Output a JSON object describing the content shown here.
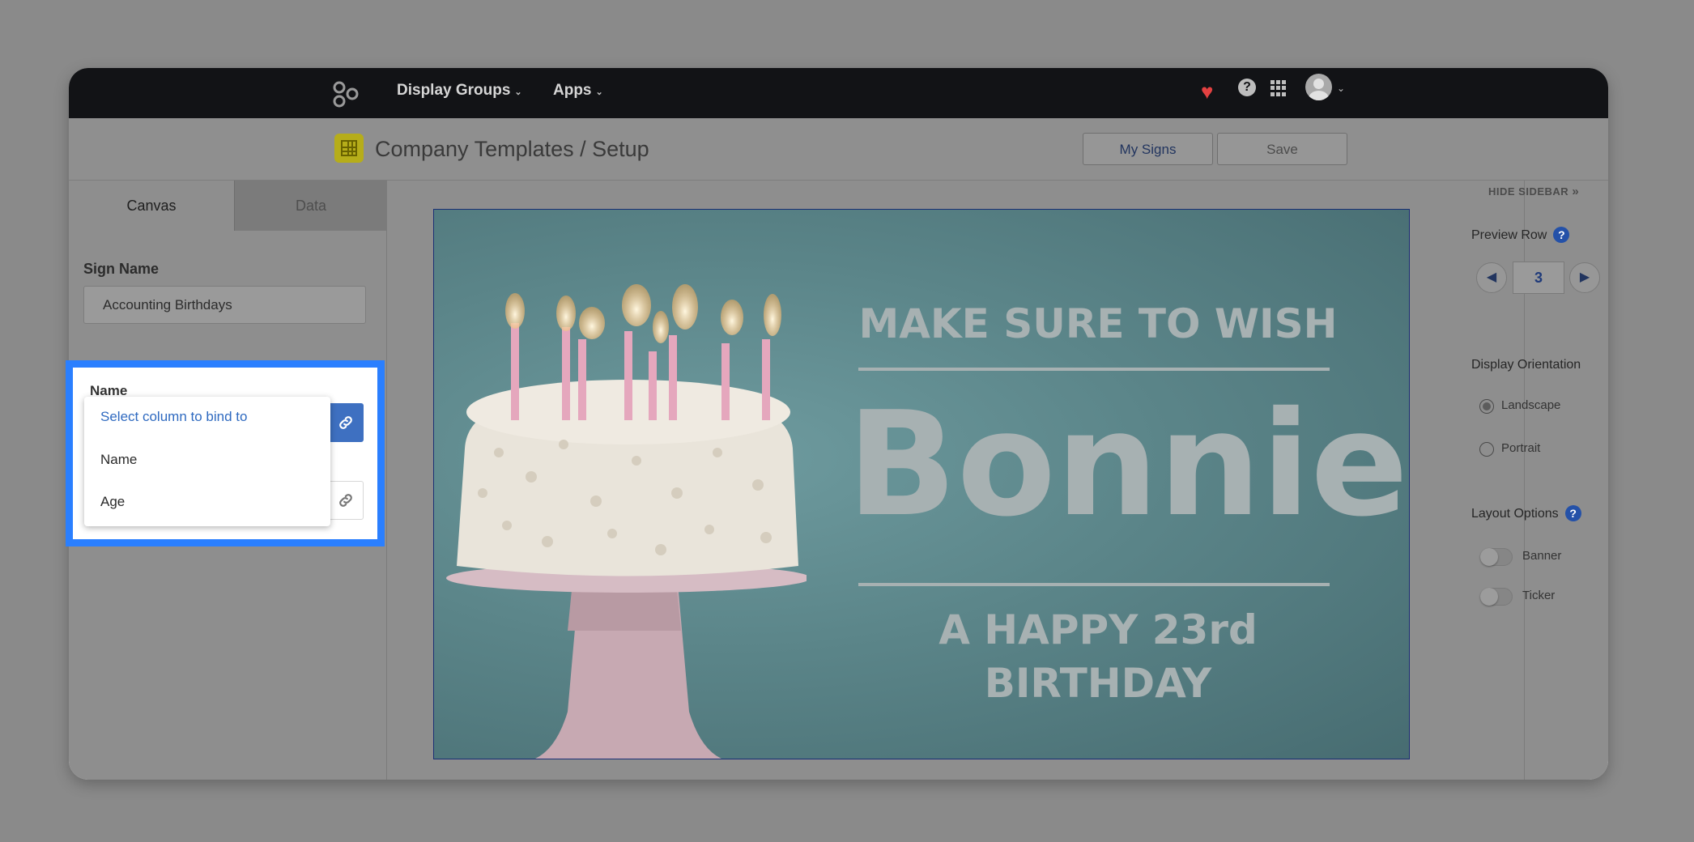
{
  "nav": {
    "items": [
      "Display Groups",
      "Apps"
    ]
  },
  "header": {
    "title": "Company Templates / Setup",
    "my_signs_label": "My Signs",
    "save_label": "Save"
  },
  "left_panel": {
    "tabs": [
      "Canvas",
      "Data"
    ],
    "sign_name_label": "Sign Name",
    "sign_name_value": "Accounting Birthdays",
    "binding_label": "Name",
    "dropdown": {
      "hint": "Select column to bind to",
      "options": [
        "Name",
        "Age"
      ]
    }
  },
  "sign": {
    "line1": "MAKE SURE TO WISH",
    "name": "Bonnie",
    "line3a": "A HAPPY 23rd",
    "line3b": "BIRTHDAY"
  },
  "right_panel": {
    "hide_sidebar": "HIDE SIDEBAR",
    "preview_row_label": "Preview Row",
    "preview_row_value": "3",
    "display_orientation_label": "Display Orientation",
    "orientation_options": [
      "Landscape",
      "Portrait"
    ],
    "orientation_selected": "Landscape",
    "layout_options_label": "Layout Options",
    "layout_options": [
      "Banner",
      "Ticker"
    ]
  },
  "colors": {
    "highlight": "#2a7fff",
    "accent_blue": "#3e70c1",
    "heart": "#e34141"
  }
}
